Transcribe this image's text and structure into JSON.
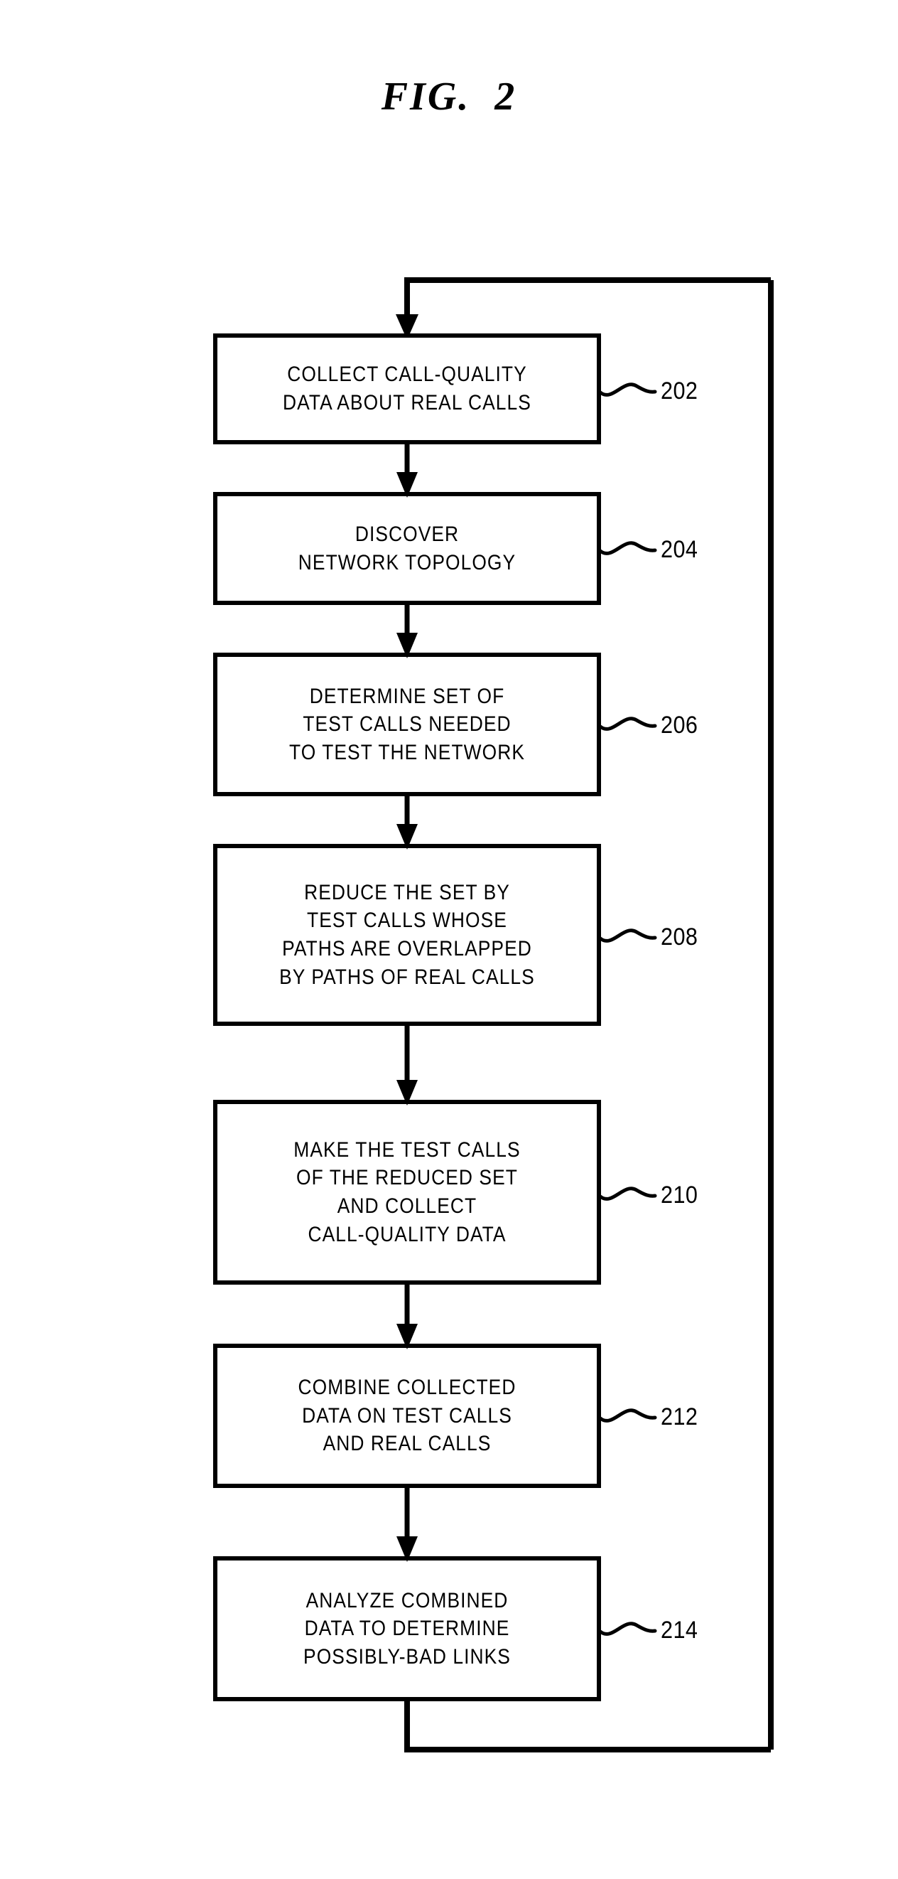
{
  "figure": {
    "title": "FIG.  2",
    "type": "patent-flowchart",
    "ink_color": "#000000",
    "background_color": "#ffffff"
  },
  "flowchart": {
    "orientation": "vertical",
    "has_feedback_loop": true,
    "feedback_loop_description": "Output of last step routes right, up the right margin, across the top, and back down into the first step",
    "steps": [
      {
        "ref": "202",
        "lines": [
          "COLLECT CALL-QUALITY",
          "DATA ABOUT REAL CALLS"
        ],
        "line1": "COLLECT CALL-QUALITY",
        "line2": "DATA ABOUT REAL CALLS",
        "line3": "",
        "line4": ""
      },
      {
        "ref": "204",
        "lines": [
          "DISCOVER",
          "NETWORK TOPOLOGY"
        ],
        "line1": "DISCOVER",
        "line2": "NETWORK TOPOLOGY",
        "line3": "",
        "line4": ""
      },
      {
        "ref": "206",
        "lines": [
          "DETERMINE SET OF",
          "TEST CALLS NEEDED",
          "TO TEST THE NETWORK"
        ],
        "line1": "DETERMINE SET OF",
        "line2": "TEST CALLS NEEDED",
        "line3": "TO TEST THE NETWORK",
        "line4": ""
      },
      {
        "ref": "208",
        "lines": [
          "REDUCE THE SET BY",
          "TEST CALLS WHOSE",
          "PATHS ARE OVERLAPPED",
          "BY PATHS OF REAL CALLS"
        ],
        "line1": "REDUCE THE SET BY",
        "line2": "TEST CALLS WHOSE",
        "line3": "PATHS ARE OVERLAPPED",
        "line4": "BY PATHS OF REAL CALLS"
      },
      {
        "ref": "210",
        "lines": [
          "MAKE THE TEST CALLS",
          "OF THE REDUCED SET",
          "AND COLLECT",
          "CALL-QUALITY DATA"
        ],
        "line1": "MAKE THE TEST CALLS",
        "line2": "OF THE REDUCED SET",
        "line3": "AND COLLECT",
        "line4": "CALL-QUALITY DATA"
      },
      {
        "ref": "212",
        "lines": [
          "COMBINE COLLECTED",
          "DATA ON TEST CALLS",
          "AND REAL CALLS"
        ],
        "line1": "COMBINE COLLECTED",
        "line2": "DATA ON TEST CALLS",
        "line3": "AND REAL CALLS",
        "line4": ""
      },
      {
        "ref": "214",
        "lines": [
          "ANALYZE COMBINED",
          "DATA TO DETERMINE",
          "POSSIBLY-BAD LINKS"
        ],
        "line1": "ANALYZE COMBINED",
        "line2": "DATA TO DETERMINE",
        "line3": "POSSIBLY-BAD LINKS",
        "line4": ""
      }
    ]
  }
}
